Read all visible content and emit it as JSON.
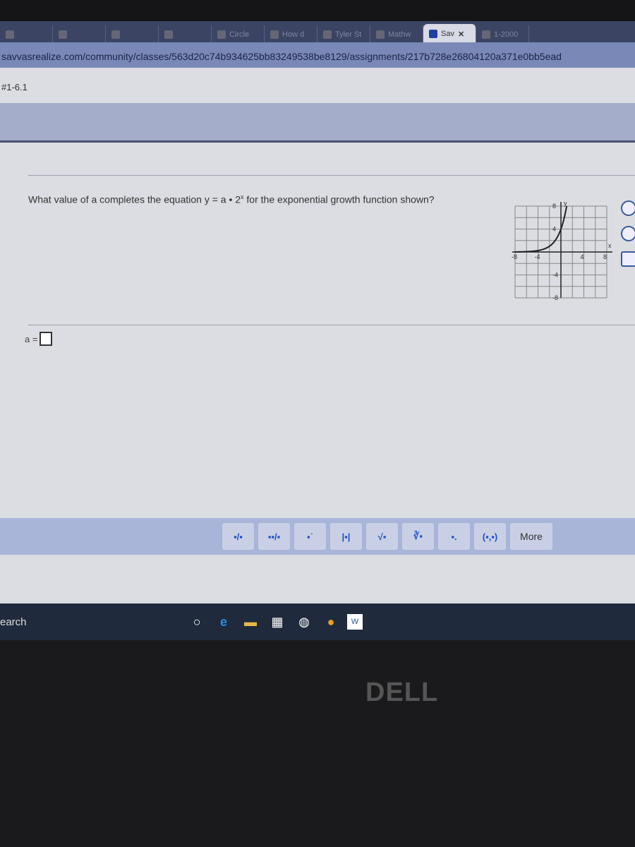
{
  "browser": {
    "tabs": [
      {
        "label": "",
        "active": false
      },
      {
        "label": "",
        "active": false
      },
      {
        "label": "",
        "active": false
      },
      {
        "label": "",
        "active": false
      },
      {
        "label": "Circle",
        "active": false
      },
      {
        "label": "How d",
        "active": false
      },
      {
        "label": "Tyler St",
        "active": false
      },
      {
        "label": "Mathw",
        "active": false
      },
      {
        "label": "Sav",
        "active": true
      },
      {
        "label": "1-2000",
        "active": false
      }
    ],
    "close_label": "✕",
    "url": "savvasrealize.com/community/classes/563d20c74b934625bb83249538be8129/assignments/217b728e26804120a371e0bb5ead"
  },
  "page": {
    "breadcrumb": "#1-6.1",
    "question_pre": "What value of a completes the equation y = a • 2",
    "question_sup": "x",
    "question_post": " for the exponential growth function shown?",
    "answer_label": "a =",
    "answer_value": ""
  },
  "graph": {
    "x_label": "x",
    "y_label": "y",
    "ticks": {
      "x": [
        "-8",
        "-4",
        "4",
        "8"
      ],
      "y": [
        "8",
        "4",
        "-4",
        "-8"
      ]
    },
    "xlim": [
      -8,
      8
    ],
    "ylim": [
      -8,
      8
    ],
    "function": "y = 4 * 2^x"
  },
  "toolbar": {
    "buttons": [
      "fraction",
      "mixed-number",
      "exponent",
      "absolute-value",
      "square-root",
      "nth-root",
      "subscript",
      "ordered-pair"
    ],
    "glyphs": [
      "▪/▪",
      "▪▪/▪",
      "▪˙",
      "|▪|",
      "√▪",
      "∛▪",
      "▪.",
      "(▪,▪)"
    ],
    "more_label": "More"
  },
  "taskbar": {
    "search_label": "earch"
  },
  "bezel": {
    "brand": "DELL"
  }
}
